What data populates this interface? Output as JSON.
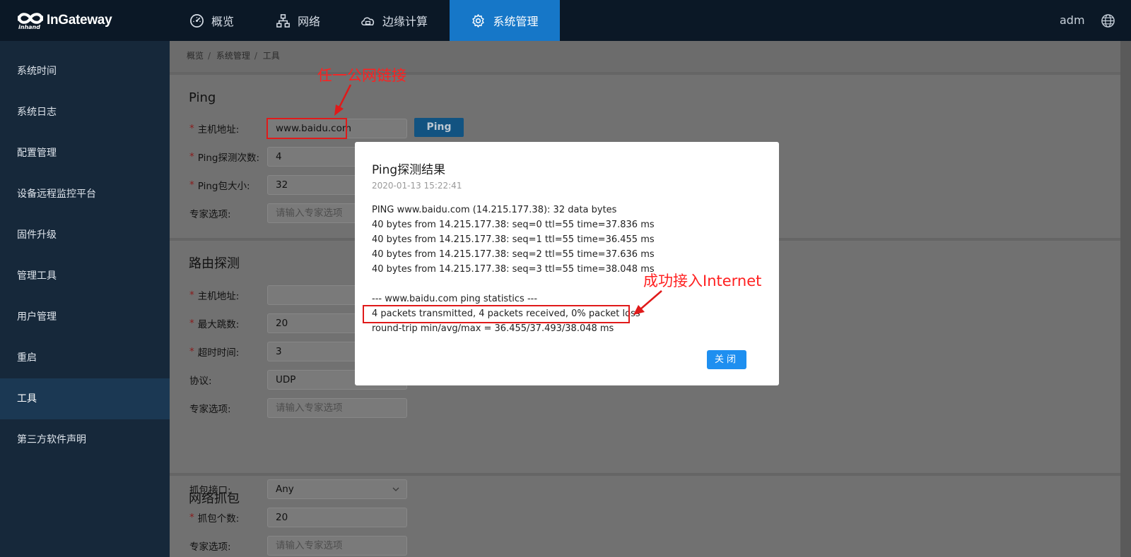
{
  "app": {
    "logo_text": "InGateway",
    "logo_sub": "inhand",
    "user": "adm"
  },
  "nav": [
    {
      "label": "概览",
      "icon": "dashboard-icon"
    },
    {
      "label": "网络",
      "icon": "network-topology-icon"
    },
    {
      "label": "边缘计算",
      "icon": "cloud-edge-icon"
    },
    {
      "label": "系统管理",
      "icon": "gear-icon",
      "active": true
    }
  ],
  "sidebar": {
    "items": [
      {
        "label": "系统时间"
      },
      {
        "label": "系统日志"
      },
      {
        "label": "配置管理"
      },
      {
        "label": "设备远程监控平台"
      },
      {
        "label": "固件升级"
      },
      {
        "label": "管理工具"
      },
      {
        "label": "用户管理"
      },
      {
        "label": "重启"
      },
      {
        "label": "工具",
        "active": true
      },
      {
        "label": "第三方软件声明"
      }
    ]
  },
  "breadcrumb": [
    "概览",
    "系统管理",
    "工具"
  ],
  "ping": {
    "title": "Ping",
    "host_label": "主机地址:",
    "host_value": "www.baidu.com",
    "count_label": "Ping探测次数:",
    "count_value": "4",
    "size_label": "Ping包大小:",
    "size_value": "32",
    "expert_label": "专家选项:",
    "expert_placeholder": "请输入专家选项",
    "button": "Ping"
  },
  "route": {
    "title": "路由探测",
    "host_label": "主机地址:",
    "host_value": "",
    "hops_label": "最大跳数:",
    "hops_value": "20",
    "timeout_label": "超时时间:",
    "timeout_value": "3",
    "protocol_label": "协议:",
    "protocol_value": "UDP",
    "expert_label": "专家选项:",
    "expert_placeholder": "请输入专家选项"
  },
  "capture": {
    "title": "网络抓包",
    "iface_label": "抓包接口:",
    "iface_value": "Any",
    "count_label": "抓包个数:",
    "count_value": "20",
    "expert_label": "专家选项:",
    "expert_placeholder": "请输入专家选项"
  },
  "modal": {
    "title": "Ping探测结果",
    "time": "2020-01-13 15:22:41",
    "lines": [
      "PING www.baidu.com (14.215.177.38): 32 data bytes",
      "40 bytes from 14.215.177.38: seq=0 ttl=55 time=37.836 ms",
      "40 bytes from 14.215.177.38: seq=1 ttl=55 time=36.455 ms",
      "40 bytes from 14.215.177.38: seq=2 ttl=55 time=37.636 ms",
      "40 bytes from 14.215.177.38: seq=3 ttl=55 time=38.048 ms",
      "",
      "--- www.baidu.com ping statistics ---",
      "4 packets transmitted, 4 packets received, 0% packet loss",
      "round-trip min/avg/max = 36.455/37.493/38.048 ms"
    ],
    "close_button": "关闭"
  },
  "annotations": {
    "top": "任一公网链接",
    "right": "成功接入Internet",
    "color": "#e01a1a"
  },
  "colors": {
    "accent": "#1677c8",
    "topbar": "#0b1826",
    "sidebar": "#16283a",
    "primary_button": "#1e8ff0"
  }
}
